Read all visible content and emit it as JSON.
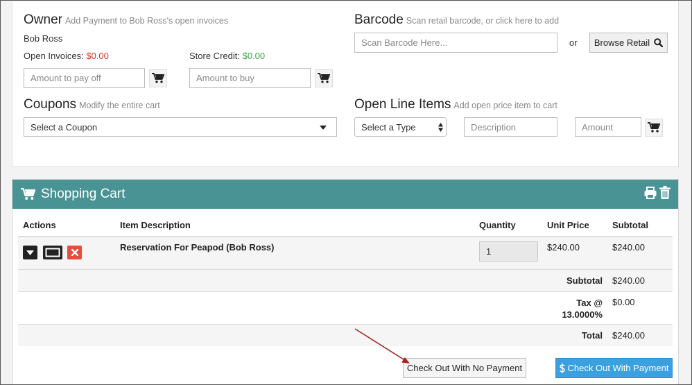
{
  "owner": {
    "title": "Owner",
    "subtitle": "Add Payment to Bob Ross's open invoices",
    "name": "Bob Ross",
    "open_invoices_label": "Open Invoices:",
    "open_invoices_value": "$0.00",
    "store_credit_label": "Store Credit:",
    "store_credit_value": "$0.00",
    "pay_off_placeholder": "Amount to pay off",
    "buy_placeholder": "Amount to buy"
  },
  "barcode": {
    "title": "Barcode",
    "subtitle": "Scan retail barcode, or click here to add",
    "placeholder": "Scan Barcode Here...",
    "or_text": "or",
    "browse_label": "Browse Retail"
  },
  "coupons": {
    "title": "Coupons",
    "subtitle": "Modify the entire cart",
    "select_value": "Select a Coupon"
  },
  "open_line_items": {
    "title": "Open Line Items",
    "subtitle": "Add open price item to cart",
    "type_value": "Select a Type",
    "description_placeholder": "Description",
    "amount_placeholder": "Amount"
  },
  "cart": {
    "title": "Shopping Cart",
    "columns": {
      "actions": "Actions",
      "item_description": "Item Description",
      "quantity": "Quantity",
      "unit_price": "Unit Price",
      "subtotal": "Subtotal"
    },
    "items": [
      {
        "description": "Reservation For Peapod (Bob Ross)",
        "quantity": "1",
        "unit_price": "$240.00",
        "subtotal": "$240.00"
      }
    ],
    "totals": {
      "subtotal_label": "Subtotal",
      "subtotal_value": "$240.00",
      "tax_label_line1": "Tax @",
      "tax_label_line2": "13.0000%",
      "tax_value": "$0.00",
      "total_label": "Total",
      "total_value": "$240.00"
    },
    "checkout_no_payment_label": "Check Out With No Payment",
    "checkout_with_payment_label": "Check Out With Payment"
  },
  "colors": {
    "cart_header": "#4a9394",
    "checkout_payment": "#3aa0e0",
    "negative": "#d9352b",
    "positive": "#3aa548",
    "annotation_arrow": "#a3261e"
  },
  "icons": {
    "cart": "cart-icon",
    "search": "search-icon",
    "print": "print-icon",
    "trash": "trash-icon",
    "dropdown": "caret-down-icon",
    "ticket": "ticket-icon",
    "remove": "close-icon",
    "dollar": "dollar-icon"
  }
}
